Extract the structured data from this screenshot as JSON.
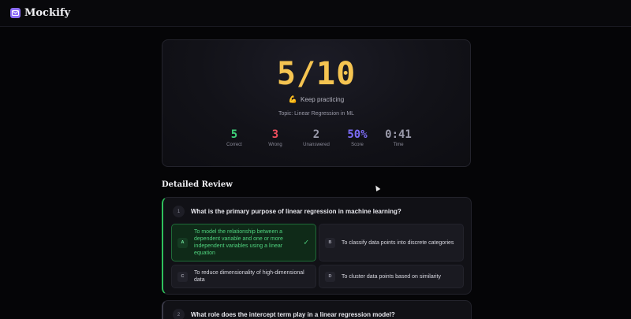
{
  "app": {
    "name": "Mockify",
    "logo_letter": "M",
    "accent": "#8b6cf6"
  },
  "result": {
    "score": "5/10",
    "message_icon": "flexed-biceps-icon",
    "message": "Keep practicing",
    "topic": "Topic: Linear Regression in ML",
    "stats": [
      {
        "value": "5",
        "label": "Correct",
        "color": "#3fd27a"
      },
      {
        "value": "3",
        "label": "Wrong",
        "color": "#f04f5e"
      },
      {
        "value": "2",
        "label": "Unanswered",
        "color": "#9a9aaa"
      },
      {
        "value": "50%",
        "label": "Score",
        "color": "#7c6cf6"
      },
      {
        "value": "0:41",
        "label": "Time",
        "color": "#9a9aaa"
      }
    ]
  },
  "review": {
    "title": "Detailed Review",
    "questions": [
      {
        "number": "1",
        "text": "What is the primary purpose of linear regression in machine learning?",
        "status": "correct",
        "options": [
          {
            "letter": "A",
            "text": "To model the relationship between a dependent variable and one or more independent variables using a linear equation",
            "selected": true,
            "check": "✓"
          },
          {
            "letter": "B",
            "text": "To classify data points into discrete categories",
            "selected": false
          },
          {
            "letter": "C",
            "text": "To reduce dimensionality of high-dimensional data",
            "selected": false
          },
          {
            "letter": "D",
            "text": "To cluster data points based on similarity",
            "selected": false
          }
        ]
      },
      {
        "number": "2",
        "text": "What role does the intercept term play in a linear regression model?",
        "status": "neutral"
      }
    ]
  }
}
